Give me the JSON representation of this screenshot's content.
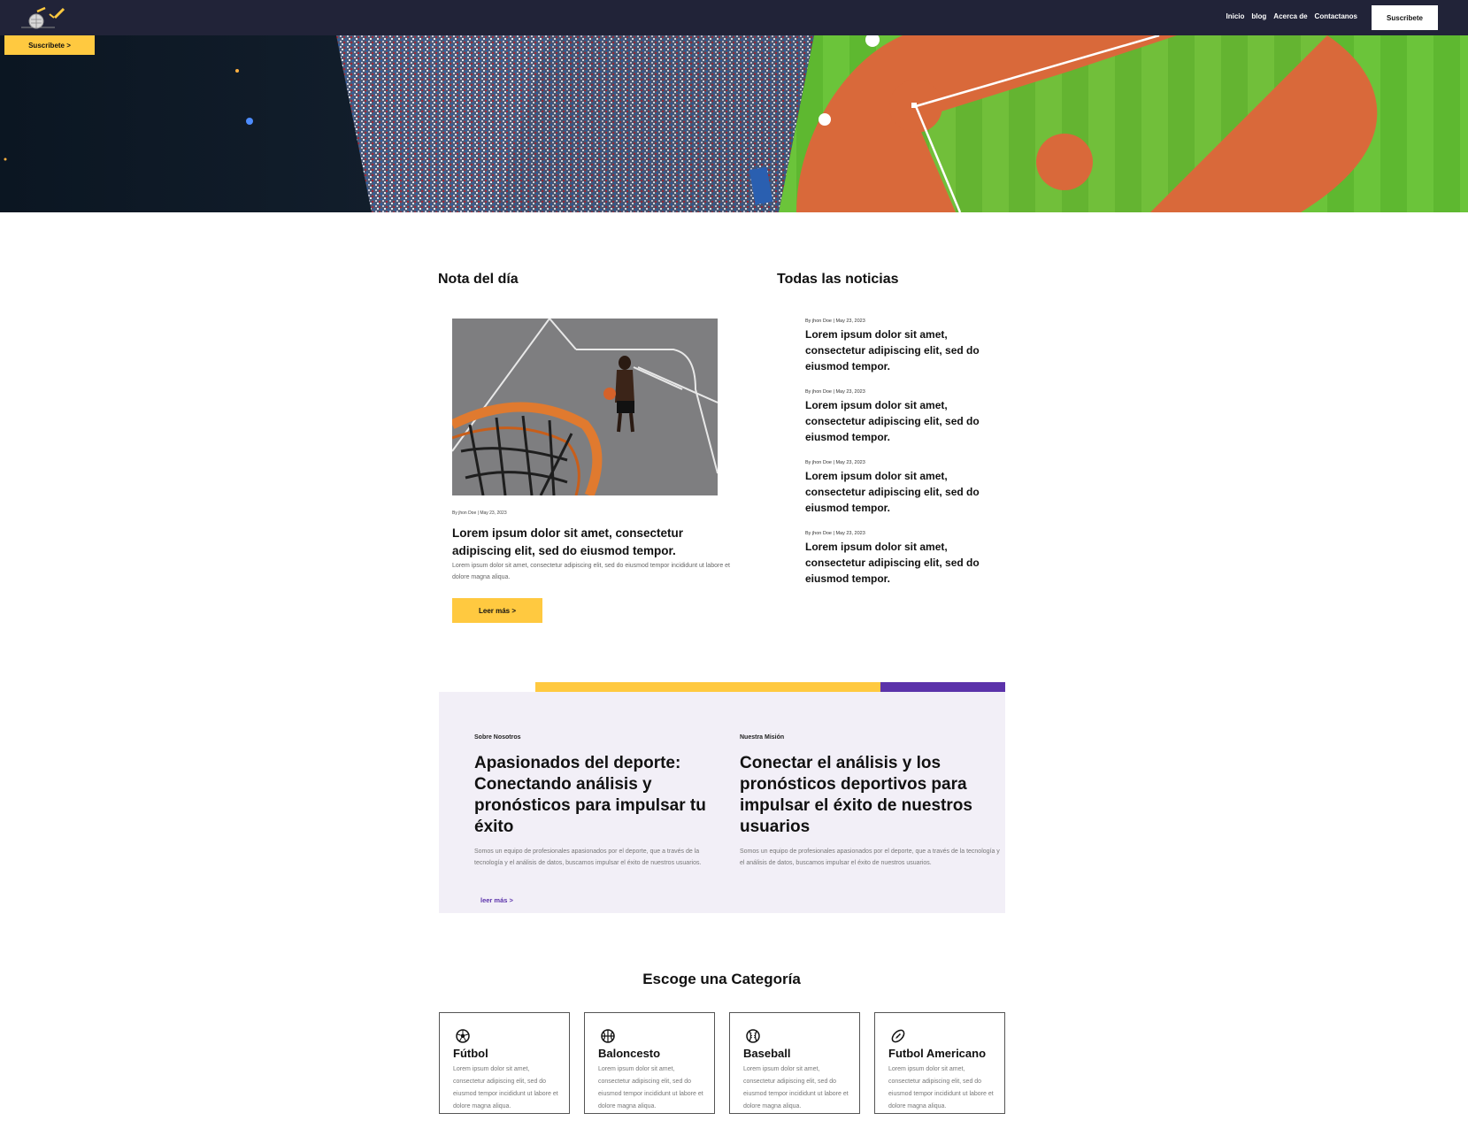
{
  "nav": {
    "links": [
      "Inicio",
      "blog",
      "Acerca de",
      "Contactanos"
    ],
    "subscribe_label": "Suscribete"
  },
  "hero": {
    "subscribe_label": "Suscribete >"
  },
  "featured": {
    "heading": "Nota del día",
    "meta": "By jhon Doe | May 23, 2023",
    "title": "Lorem ipsum dolor sit amet, consectetur adipiscing elit, sed do eiusmod tempor.",
    "text": "Lorem ipsum dolor sit amet, consectetur adipiscing elit, sed do eiusmod tempor incididunt ut labore et dolore magna aliqua.",
    "button": "Leer más >"
  },
  "news": {
    "heading": "Todas las noticias",
    "items": [
      {
        "meta": "By jhon Doe | May 23, 2023",
        "title": "Lorem ipsum dolor sit amet, consectetur adipiscing elit, sed do eiusmod tempor."
      },
      {
        "meta": "By jhon Doe | May 23, 2023",
        "title": "Lorem ipsum dolor sit amet, consectetur adipiscing elit, sed do eiusmod tempor."
      },
      {
        "meta": "By jhon Doe | May 23, 2023",
        "title": "Lorem ipsum dolor sit amet, consectetur adipiscing elit, sed do eiusmod tempor."
      },
      {
        "meta": "By jhon Doe | May 23, 2023",
        "title": "Lorem ipsum dolor sit amet, consectetur adipiscing elit, sed do eiusmod tempor."
      }
    ]
  },
  "about": {
    "left": {
      "kicker": "Sobre Nosotros",
      "title": "Apasionados del deporte: Conectando análisis y pronósticos para impulsar tu éxito",
      "text": "Somos un equipo de profesionales apasionados por el deporte, que a través de la tecnología y el análisis de datos, buscamos impulsar el éxito de nuestros usuarios."
    },
    "right": {
      "kicker": "Nuestra Misión",
      "title": "Conectar el análisis y los pronósticos deportivos para impulsar el éxito de nuestros usuarios",
      "text": "Somos un equipo de profesionales apasionados por el deporte, que a través de la tecnología y el análisis de datos, buscamos impulsar el éxito de nuestros usuarios."
    },
    "link": "leer más >"
  },
  "categories": {
    "heading": "Escoge una Categoría",
    "items": [
      {
        "icon": "soccer-ball-icon",
        "name": "Fútbol",
        "text": "Lorem ipsum dolor sit amet, consectetur adipiscing elit, sed do eiusmod tempor incididunt ut labore et dolore magna aliqua."
      },
      {
        "icon": "basketball-icon",
        "name": "Baloncesto",
        "text": "Lorem ipsum dolor sit amet, consectetur adipiscing elit, sed do eiusmod tempor incididunt ut labore et dolore magna aliqua."
      },
      {
        "icon": "baseball-icon",
        "name": "Baseball",
        "text": "Lorem ipsum dolor sit amet, consectetur adipiscing elit, sed do eiusmod tempor incididunt ut labore et dolore magna aliqua."
      },
      {
        "icon": "football-icon",
        "name": "Futbol Americano",
        "text": "Lorem ipsum dolor sit amet, consectetur adipiscing elit, sed do eiusmod tempor incididunt ut labore et dolore magna aliqua."
      }
    ]
  },
  "colors": {
    "nav_bg": "#212338",
    "accent_yellow": "#ffc940",
    "accent_purple": "#5b32aa",
    "about_bg": "#f2eff7"
  }
}
